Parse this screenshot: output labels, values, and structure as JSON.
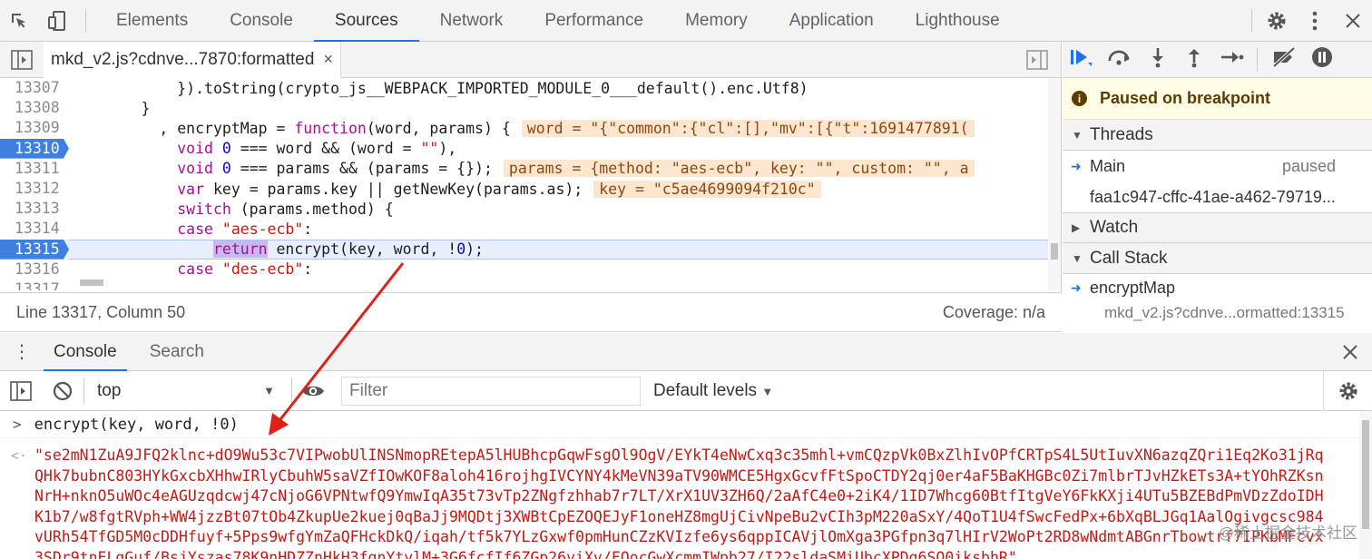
{
  "top_tabs": [
    "Elements",
    "Console",
    "Sources",
    "Network",
    "Performance",
    "Memory",
    "Application",
    "Lighthouse"
  ],
  "active_top_tab": "Sources",
  "file_tab": {
    "name": "mkd_v2.js?cdnve...7870:formatted",
    "close": "×"
  },
  "code_lines": [
    {
      "n": "13307",
      "bp": false
    },
    {
      "n": "13308",
      "bp": false
    },
    {
      "n": "13309",
      "bp": false
    },
    {
      "n": "13310",
      "bp": true
    },
    {
      "n": "13311",
      "bp": false
    },
    {
      "n": "13312",
      "bp": false
    },
    {
      "n": "13313",
      "bp": false
    },
    {
      "n": "13314",
      "bp": false
    },
    {
      "n": "13315",
      "bp": true
    },
    {
      "n": "13316",
      "bp": false
    },
    {
      "n": "13317",
      "bp": false
    }
  ],
  "code_text": {
    "l13307": "            }).toString(crypto_js__WEBPACK_IMPORTED_MODULE_0___default().enc.Utf8)",
    "l13308": "        }",
    "l13309a": "          , encryptMap = ",
    "l13309b": "function",
    "l13309c": "(word, params) {",
    "l13309_inline": "word = \"{\"common\":{\"cl\":[],\"mv\":[{\"t\":1691477891(",
    "l13310a": "            void ",
    "l13310b": "0",
    "l13310c": " === word && (word = ",
    "l13310d": "\"\"",
    "l13310e": "),",
    "l13311a": "            void ",
    "l13311b": "0",
    "l13311c": " === params && (params = {});",
    "l13311_inline": "params = {method: \"aes-ecb\", key: \"\", custom: \"\", a",
    "l13312a": "            var ",
    "l13312b": "key = params.key || getNewKey(params.as);",
    "l13312_inline": "key = \"c5ae4699094f210c\"",
    "l13313a": "            switch ",
    "l13313b": "(params.method) {",
    "l13314a": "            case ",
    "l13314b": "\"aes-ecb\"",
    "l13314c": ":",
    "l13315a": "                ",
    "l13315b": "return",
    "l13315c": " ",
    "l13315d": "encrypt(key, word, !",
    "l13315e": "0",
    "l13315f": ");",
    "l13316a": "            case ",
    "l13316b": "\"des-ecb\"",
    "l13316c": ":"
  },
  "status": {
    "position": "Line 13317, Column 50",
    "coverage": "Coverage: n/a"
  },
  "debugger": {
    "paused_label": "Paused on breakpoint",
    "threads_label": "Threads",
    "main_thread": "Main",
    "main_status": "paused",
    "worker_thread": "faa1c947-cffc-41ae-a462-79719...",
    "watch_label": "Watch",
    "call_stack_label": "Call Stack",
    "frame_name": "encryptMap",
    "frame_location": "mkd_v2.js?cdnve...ormatted:13315"
  },
  "drawer": {
    "tabs": [
      "Console",
      "Search"
    ],
    "context": "top",
    "filter_placeholder": "Filter",
    "levels": "Default levels"
  },
  "console": {
    "input": "encrypt(key, word, !0)",
    "output": "\"se2mN1ZuA9JFQ2klnc+dO9Wu53c7VIPwobUlINSNmopREtepA5lHUBhcpGqwFsgOl9OgV/EYkT4eNwCxq3c35mhl+vmCQzpVk0BxZlhIvOPfCRTpS4L5UtIuvXN6azqZQri1Eq2Ko31jRqQHk7bubnC803HYkGxcbXHhwIRlyCbuhW5saVZfIOwKOF8aloh416rojhgIVCYNY4kMeVN39aTV90WMCE5HgxGcvfFtSpoCTDY2qj0er4aF5BaKHGBc0Zi7mlbrTJvHZkETs3A+tYOhRZKsnNrH+nknO5uWOc4eAGUzqdcwj47cNjoG6VPNtwfQ9YmwIqA35t73vTp2ZNgfzhhab7r7LT/XrX1UV3ZH6Q/2aAfC4e0+2iK4/1ID7Whcg60BtfItgVeY6FkKXji4UTu5BZEBdPmVDzZdoIDHK1b7/w8fgtRVph+WW4jzzBt07tOb4ZkupUe2kuej0qBaJj9MQDtj3XWBtCpEZOQEJyF1oneHZ8mgUjCivNpeBu2vCIh3pM220aSxY/4QoT1U4fSwcFedPx+6bXqBLJGq1AalOgivgcsc984vURh54TfGD5M0cDDHfuyf+5Pps9wfgYmZaQFHckDkQ/iqah/tf5k7YLzGxwf0pmHunCZzKVIzfe6ys6qppICAVjlOmXga3PGfpn3q7lHIrV2WoPt2RD8wNdmtABGnrTbowtrf7IPKbMFcvx3SDr9tnELgGuf/BsjYszas78K9nHDZZnHkH3fgnYtvlM+3G6fcfIf6ZGp26viXv/FOocGwXcmmIWpb27/I22sldaSMiUbcXPDg6SO0iksbhR\""
  },
  "watermark": "@稀土掘金技术社区"
}
